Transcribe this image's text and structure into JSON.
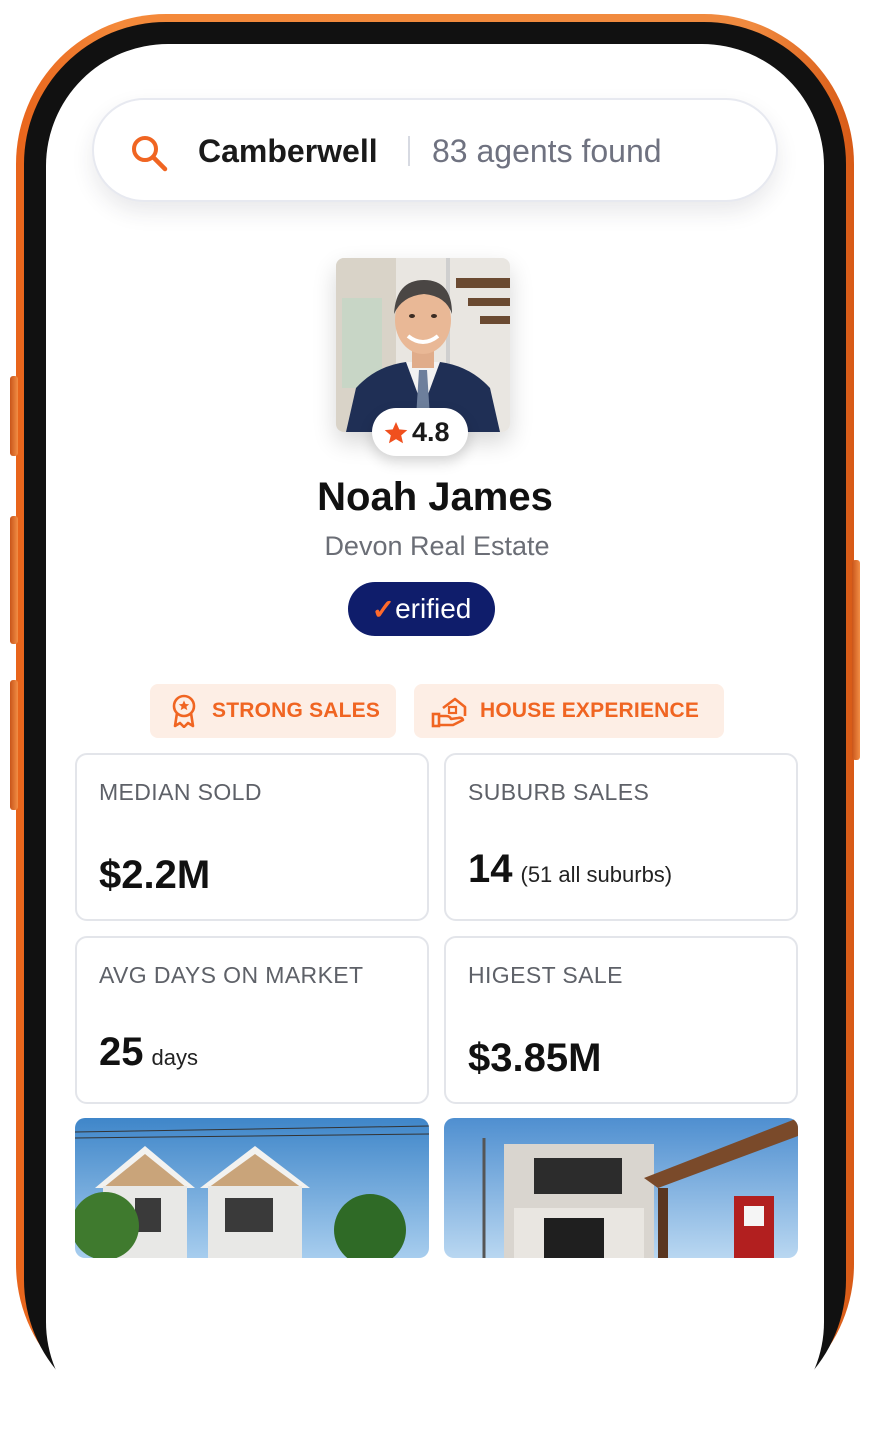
{
  "search": {
    "location": "Camberwell",
    "result_count": "83 agents found"
  },
  "agent": {
    "rating": "4.8",
    "name": "Noah James",
    "agency": "Devon Real Estate",
    "verified_check": "✓",
    "verified_label": "erified"
  },
  "tags": [
    {
      "label": "STRONG SALES",
      "icon": "award-ribbon-icon"
    },
    {
      "label": "HOUSE EXPERIENCE",
      "icon": "house-hand-icon"
    }
  ],
  "stats": [
    {
      "label": "MEDIAN SOLD",
      "value": "$2.2M",
      "suffix": ""
    },
    {
      "label": "SUBURB SALES",
      "value": "14",
      "suffix": "(51 all suburbs)"
    },
    {
      "label": "AVG DAYS ON MARKET",
      "value": "25",
      "suffix": "days"
    },
    {
      "label": "HIGEST SALE",
      "value": "$3.85M",
      "suffix": ""
    }
  ],
  "colors": {
    "accent": "#f06522",
    "verified_bg": "#0f1d6b",
    "tag_bg": "#fdeee5",
    "phone_frame": "#f08a3f"
  }
}
